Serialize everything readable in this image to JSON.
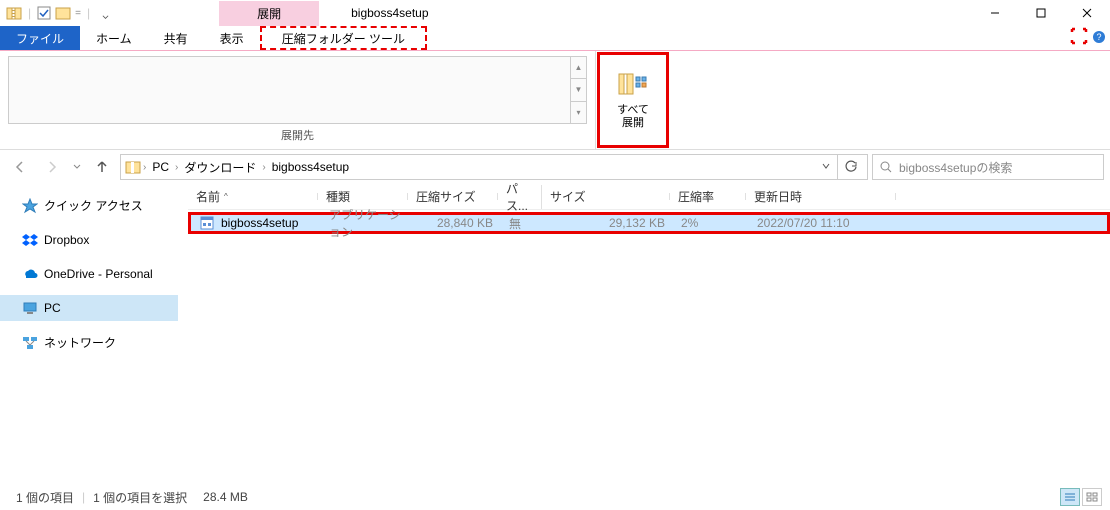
{
  "window": {
    "context_tab": "展開",
    "title": "bigboss4setup"
  },
  "ribbon": {
    "file": "ファイル",
    "home": "ホーム",
    "share": "共有",
    "view": "表示",
    "compressed_tools": "圧縮フォルダー ツール",
    "extract_to_label": "展開先",
    "extract_all_line1": "すべて",
    "extract_all_line2": "展開"
  },
  "address": {
    "crumbs": [
      "PC",
      "ダウンロード",
      "bigboss4setup"
    ],
    "search_placeholder": "bigboss4setupの検索"
  },
  "sidebar": {
    "quick_access": "クイック アクセス",
    "dropbox": "Dropbox",
    "onedrive": "OneDrive - Personal",
    "pc": "PC",
    "network": "ネットワーク"
  },
  "columns": {
    "name": "名前",
    "type": "種類",
    "compressed_size": "圧縮サイズ",
    "password": "パス...",
    "size": "サイズ",
    "ratio": "圧縮率",
    "date": "更新日時"
  },
  "files": [
    {
      "name": "bigboss4setup",
      "type": "アプリケーション",
      "compressed_size": "28,840 KB",
      "password": "無",
      "size": "29,132 KB",
      "ratio": "2%",
      "date": "2022/07/20 11:10"
    }
  ],
  "status": {
    "item_count": "1 個の項目",
    "selected": "1 個の項目を選択",
    "size": "28.4 MB"
  }
}
